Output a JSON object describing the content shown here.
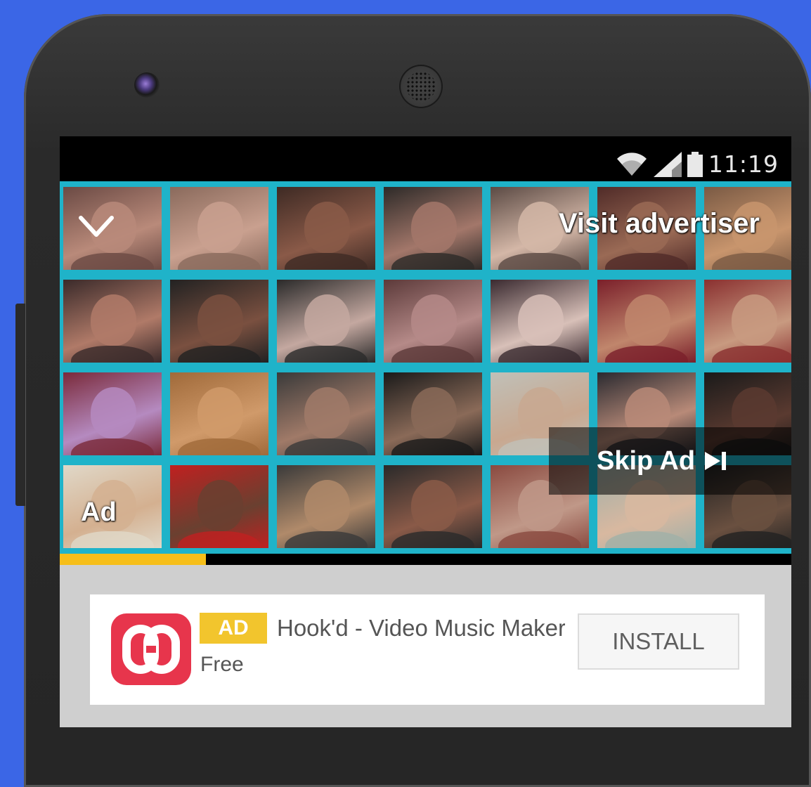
{
  "status_bar": {
    "time": "11:19",
    "icons": [
      "wifi-icon",
      "signal-icon",
      "battery-icon"
    ]
  },
  "video_ad": {
    "visit_advertiser_label": "Visit advertiser",
    "skip_ad_label": "Skip Ad",
    "ad_label": "Ad",
    "progress": 0.2,
    "colors": {
      "grid_lines": "#1fb3c9",
      "progress": "#f6be19",
      "track": "#000000"
    },
    "icons": [
      "chevron-down-icon",
      "skip-next-icon"
    ]
  },
  "ad_card": {
    "badge": "AD",
    "app_name": "Hook'd - Video Music Maker",
    "price": "Free",
    "install_label": "INSTALL",
    "colors": {
      "badge": "#f2c52d",
      "app_icon": "#e7354c"
    },
    "app_icon": "chain-link-icon"
  }
}
